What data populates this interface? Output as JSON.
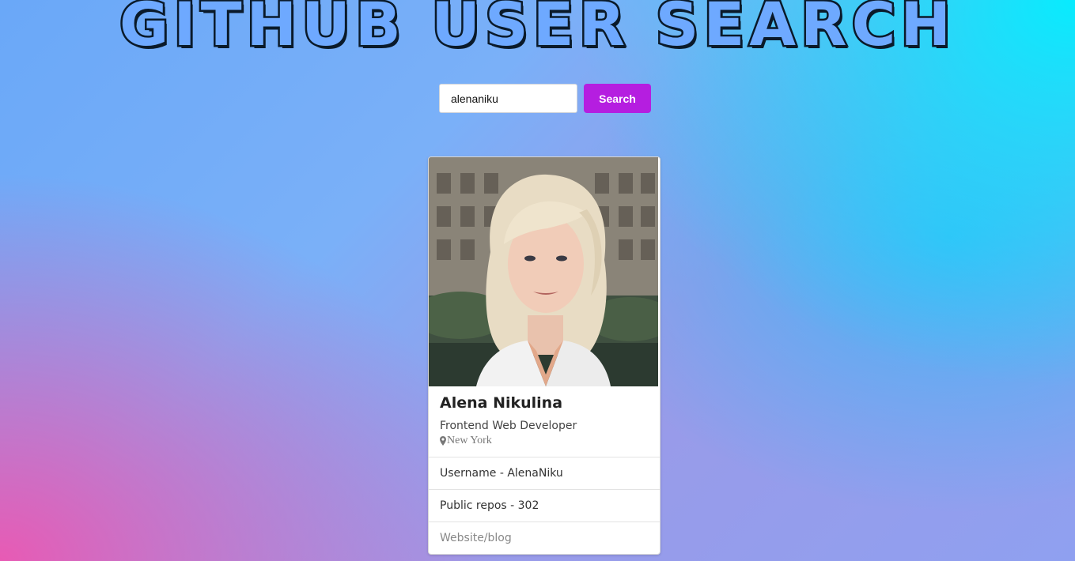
{
  "header": {
    "title": "GITHUB USER SEARCH"
  },
  "search": {
    "value": "alenaniku",
    "button_label": "Search"
  },
  "profile": {
    "name": "Alena Nikulina",
    "bio": "Frontend Web Developer",
    "location": "New York",
    "location_icon": "map-pin-icon",
    "username": "Username - AlenaNiku",
    "public_repos": "Public repos - 302",
    "website": "Website/blog"
  },
  "colors": {
    "accent_button": "#b51ee0",
    "title_fill": "#6ea9ff",
    "title_outline": "#0a1a2a"
  }
}
